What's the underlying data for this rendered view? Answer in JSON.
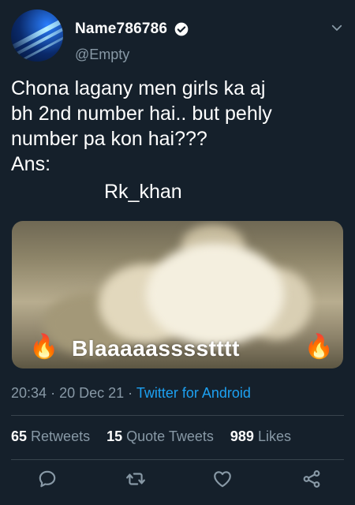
{
  "user": {
    "display_name": "Name786786",
    "handle": "@Empty",
    "verified": true
  },
  "tweet": {
    "text": "Chona lagany men girls ka aj\nbh 2nd number hai.. but pehly\nnumber pa kon hai???\nAns:",
    "answer": "Rk_khan",
    "media_caption": "Blaaaaasssstttt",
    "time": "20:34",
    "separator": "·",
    "date": "20 Dec 21",
    "source": "Twitter for Android"
  },
  "stats": {
    "retweets_count": "65",
    "retweets_label": "Retweets",
    "quote_count": "15",
    "quote_label": "Quote Tweets",
    "likes_count": "989",
    "likes_label": "Likes"
  },
  "icons": {
    "reply": "reply-icon",
    "retweet": "retweet-icon",
    "like": "heart-icon",
    "share": "share-icon",
    "menu": "chevron-down-icon",
    "verified": "verified-badge-icon",
    "fire": "fire-emoji"
  },
  "colors": {
    "background": "#15202b",
    "text": "#ffffff",
    "muted": "#8899a6",
    "link": "#1da1f2",
    "divider": "#38444d"
  }
}
